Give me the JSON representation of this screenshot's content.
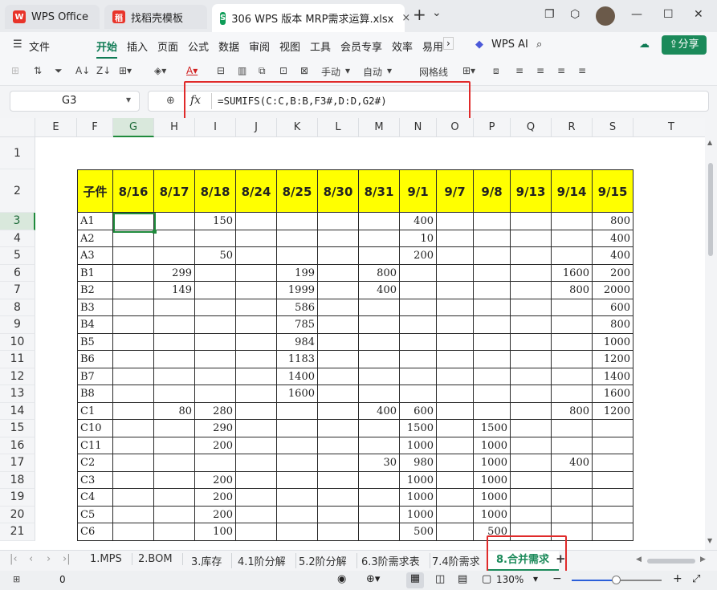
{
  "titlebar": {
    "tabs": [
      {
        "label": "WPS Office",
        "logo": "W",
        "color": "#e8342a"
      },
      {
        "label": "找稻壳模板",
        "logo": "稻",
        "color": "#e8342a"
      },
      {
        "label": "306 WPS 版本 MRP需求运算.xlsx",
        "logo": "S",
        "color": "#0f9d58"
      }
    ],
    "close_tab": "×",
    "new_tab": "+",
    "tab_list": "⌄"
  },
  "menu": {
    "items": [
      "文件",
      "开始",
      "插入",
      "页面",
      "公式",
      "数据",
      "审阅",
      "视图",
      "工具",
      "会员专享",
      "效率",
      "易用"
    ],
    "active": "开始",
    "wps_ai": "WPS AI",
    "share": "分享"
  },
  "toolbar": {
    "manual": "手动",
    "auto": "自动",
    "gridlines": "网格线"
  },
  "formula": {
    "cell_ref": "G3",
    "fx": "fx",
    "text": "=SUMIFS(C:C,B:B,F3#,D:D,G2#)"
  },
  "columns": [
    "E",
    "F",
    "G",
    "H",
    "I",
    "J",
    "K",
    "L",
    "M",
    "N",
    "O",
    "P",
    "Q",
    "R",
    "S",
    "T"
  ],
  "rows": [
    "1",
    "2",
    "3",
    "4",
    "5",
    "6",
    "7",
    "8",
    "9",
    "10",
    "11",
    "12",
    "13",
    "14",
    "15",
    "16",
    "17",
    "18",
    "19",
    "20",
    "21"
  ],
  "table": {
    "header": [
      "子件",
      "8/16",
      "8/17",
      "8/18",
      "8/24",
      "8/25",
      "8/30",
      "8/31",
      "9/1",
      "9/7",
      "9/8",
      "9/13",
      "9/14",
      "9/15"
    ],
    "data": [
      [
        "A1",
        "",
        "",
        "150",
        "",
        "",
        "",
        "",
        "400",
        "",
        "",
        "",
        "",
        "800"
      ],
      [
        "A2",
        "",
        "",
        "",
        "",
        "",
        "",
        "",
        "10",
        "",
        "",
        "",
        "",
        "400"
      ],
      [
        "A3",
        "",
        "",
        "50",
        "",
        "",
        "",
        "",
        "200",
        "",
        "",
        "",
        "",
        "400"
      ],
      [
        "B1",
        "",
        "299",
        "",
        "",
        "199",
        "",
        "800",
        "",
        "",
        "",
        "",
        "1600",
        "200"
      ],
      [
        "B2",
        "",
        "149",
        "",
        "",
        "1999",
        "",
        "400",
        "",
        "",
        "",
        "",
        "800",
        "2000"
      ],
      [
        "B3",
        "",
        "",
        "",
        "",
        "586",
        "",
        "",
        "",
        "",
        "",
        "",
        "",
        "600"
      ],
      [
        "B4",
        "",
        "",
        "",
        "",
        "785",
        "",
        "",
        "",
        "",
        "",
        "",
        "",
        "800"
      ],
      [
        "B5",
        "",
        "",
        "",
        "",
        "984",
        "",
        "",
        "",
        "",
        "",
        "",
        "",
        "1000"
      ],
      [
        "B6",
        "",
        "",
        "",
        "",
        "1183",
        "",
        "",
        "",
        "",
        "",
        "",
        "",
        "1200"
      ],
      [
        "B7",
        "",
        "",
        "",
        "",
        "1400",
        "",
        "",
        "",
        "",
        "",
        "",
        "",
        "1400"
      ],
      [
        "B8",
        "",
        "",
        "",
        "",
        "1600",
        "",
        "",
        "",
        "",
        "",
        "",
        "",
        "1600"
      ],
      [
        "C1",
        "",
        "80",
        "280",
        "",
        "",
        "",
        "400",
        "600",
        "",
        "",
        "",
        "800",
        "1200"
      ],
      [
        "C10",
        "",
        "",
        "290",
        "",
        "",
        "",
        "",
        "1500",
        "",
        "1500",
        "",
        "",
        ""
      ],
      [
        "C11",
        "",
        "",
        "200",
        "",
        "",
        "",
        "",
        "1000",
        "",
        "1000",
        "",
        "",
        ""
      ],
      [
        "C2",
        "",
        "",
        "",
        "",
        "",
        "",
        "30",
        "980",
        "",
        "1000",
        "",
        "400",
        ""
      ],
      [
        "C3",
        "",
        "",
        "200",
        "",
        "",
        "",
        "",
        "1000",
        "",
        "1000",
        "",
        "",
        ""
      ],
      [
        "C4",
        "",
        "",
        "200",
        "",
        "",
        "",
        "",
        "1000",
        "",
        "1000",
        "",
        "",
        ""
      ],
      [
        "C5",
        "",
        "",
        "200",
        "",
        "",
        "",
        "",
        "1000",
        "",
        "1000",
        "",
        "",
        ""
      ],
      [
        "C6",
        "",
        "",
        "100",
        "",
        "",
        "",
        "",
        "500",
        "",
        "500",
        "",
        "",
        ""
      ]
    ]
  },
  "sheets": [
    "1.MPS",
    "2.BOM",
    "3.库存",
    "4.1阶分解",
    "5.2阶分解",
    "6.3阶需求表",
    "7.4阶需求",
    "8.合并需求"
  ],
  "active_sheet": "8.合并需求",
  "status": {
    "count": "0",
    "zoom": "130%"
  }
}
